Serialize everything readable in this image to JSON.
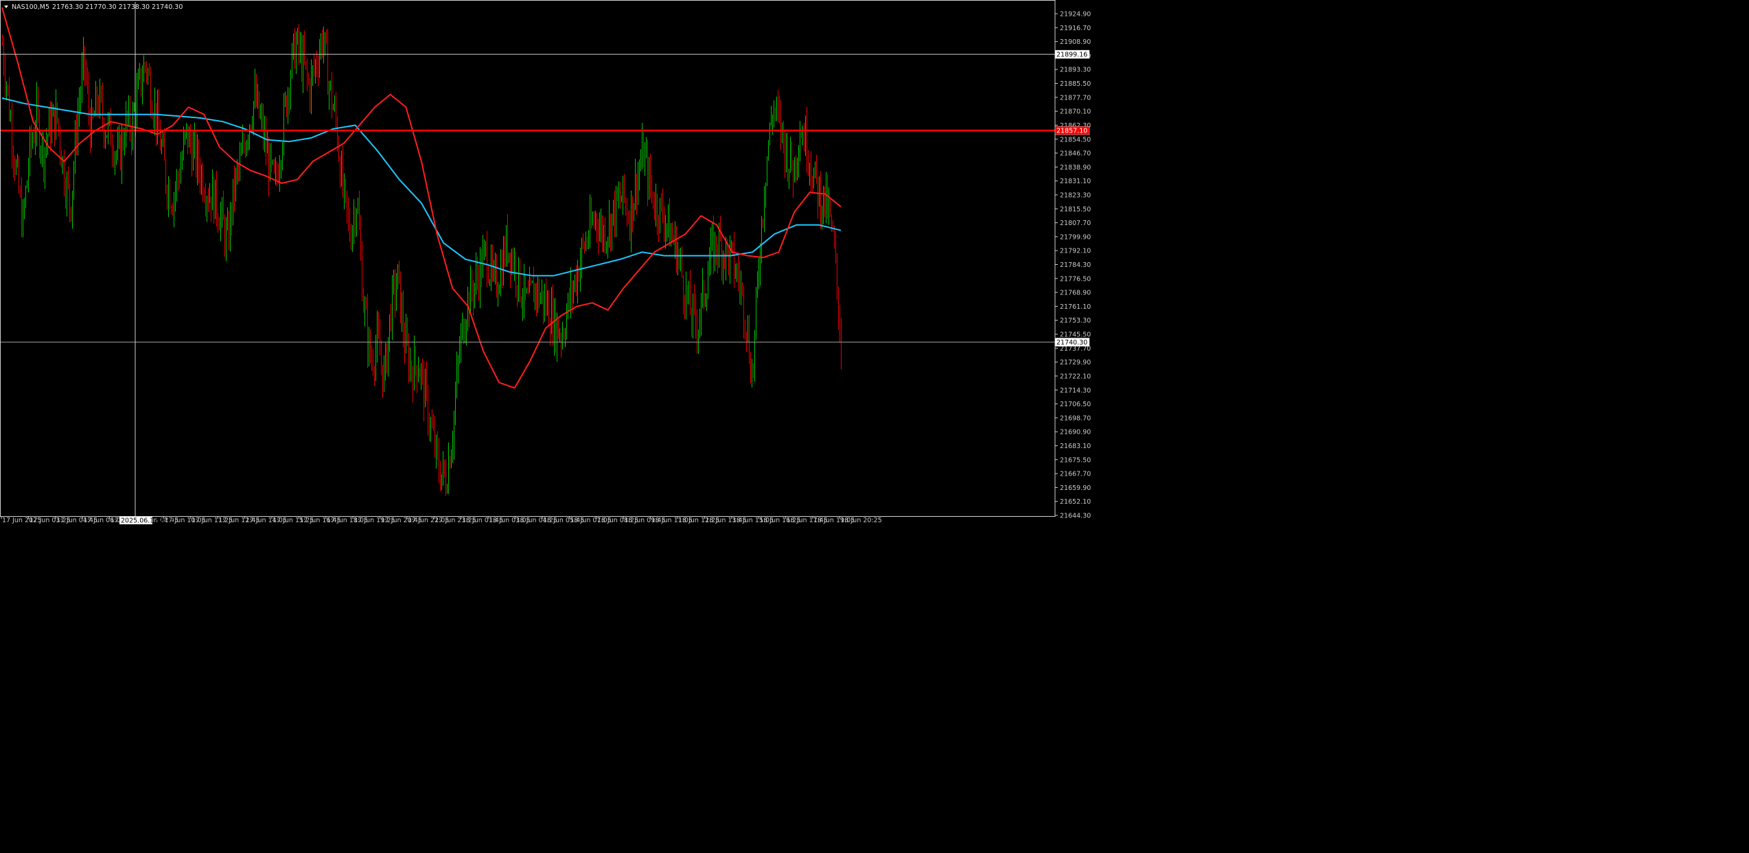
{
  "header": {
    "symbol": "NAS100,M5",
    "ohlc_text": "21763.30 21770.30 21738.30 21740.30"
  },
  "crosshair": {
    "time_label": "2025.06.17 8:40",
    "price_label": "21899.16"
  },
  "price_markers": {
    "bid_line_label": "21857.10",
    "current_price_label": "21740.30"
  },
  "colors": {
    "background": "#000000",
    "bull_candle": "#00c800",
    "bear_candle": "#e60000",
    "ma_fast": "#ff1e1e",
    "ma_slow": "#1ec8ff",
    "horizontal_line": "#ff0000",
    "crosshair": "#d0d0d0",
    "axis_text": "#c8c8c8"
  },
  "chart_data": {
    "type": "candlestick",
    "symbol": "NAS100",
    "timeframe": "M5",
    "ylim": [
      21644.3,
      21928.0
    ],
    "grid": false,
    "y_ticks": [
      "21924.90",
      "21916.70",
      "21908.90",
      "21901.10",
      "21893.30",
      "21885.50",
      "21877.70",
      "21870.10",
      "21862.30",
      "21854.50",
      "21846.70",
      "21838.90",
      "21831.10",
      "21823.30",
      "21815.50",
      "21807.70",
      "21799.90",
      "21792.10",
      "21784.30",
      "21776.50",
      "21768.90",
      "21761.10",
      "21753.30",
      "21745.50",
      "21737.70",
      "21729.90",
      "21722.10",
      "21714.30",
      "21706.50",
      "21698.70",
      "21690.90",
      "21683.10",
      "21675.50",
      "21667.70",
      "21659.90",
      "21652.10",
      "21644.30"
    ],
    "x_ticks": [
      "17 Jun 2025",
      "17 Jun 03:25",
      "17 Jun 04:45",
      "17 Jun 06:05",
      "17 Jun 07:25",
      "17 Jun 08:45",
      "17 Jun 10:05",
      "17 Jun 11:25",
      "17 Jun 12:45",
      "17 Jun 14:05",
      "17 Jun 15:25",
      "17 Jun 16:45",
      "17 Jun 18:05",
      "17 Jun 19:25",
      "17 Jun 20:45",
      "17 Jun 22:05",
      "17 Jun 23:25",
      "18 Jun 01:45",
      "18 Jun 03:05",
      "18 Jun 04:25",
      "18 Jun 05:45",
      "18 Jun 07:05",
      "18 Jun 08:25",
      "18 Jun 09:45",
      "18 Jun 11:05",
      "18 Jun 12:25",
      "18 Jun 13:45",
      "18 Jun 15:05",
      "18 Jun 16:25",
      "18 Jun 17:45",
      "18 Jun 19:05",
      "18 Jun 20:25"
    ],
    "price_path": [
      21905,
      21870,
      21835,
      21805,
      21845,
      21865,
      21845,
      21860,
      21865,
      21835,
      21815,
      21865,
      21895,
      21855,
      21875,
      21860,
      21855,
      21840,
      21860,
      21860,
      21880,
      21895,
      21875,
      21855,
      21830,
      21820,
      21835,
      21855,
      21845,
      21835,
      21825,
      21820,
      21810,
      21795,
      21825,
      21840,
      21860,
      21875,
      21860,
      21840,
      21825,
      21855,
      21885,
      21905,
      21895,
      21880,
      21895,
      21910,
      21880,
      21860,
      21820,
      21800,
      21820,
      21760,
      21730,
      21740,
      21720,
      21760,
      21775,
      21740,
      21725,
      21730,
      21710,
      21690,
      21670,
      21665,
      21690,
      21735,
      21760,
      21770,
      21780,
      21790,
      21770,
      21780,
      21795,
      21785,
      21770,
      21760,
      21770,
      21765,
      21760,
      21750,
      21745,
      21760,
      21775,
      21790,
      21800,
      21810,
      21800,
      21805,
      21815,
      21820,
      21810,
      21830,
      21845,
      21825,
      21815,
      21810,
      21800,
      21790,
      21770,
      21755,
      21750,
      21770,
      21790,
      21795,
      21790,
      21785,
      21775,
      21755,
      21720,
      21790,
      21840,
      21870,
      21860,
      21845,
      21835,
      21860,
      21850,
      21830,
      21820,
      21815,
      21790,
      21740
    ],
    "ma_fast": [
      21925,
      21895,
      21862,
      21848,
      21840,
      21850,
      21857,
      21862,
      21860,
      21858,
      21855,
      21860,
      21870,
      21866,
      21848,
      21840,
      21835,
      21832,
      21828,
      21830,
      21840,
      21845,
      21850,
      21860,
      21870,
      21877,
      21870,
      21840,
      21800,
      21770,
      21760,
      21735,
      21718,
      21715,
      21730,
      21748,
      21755,
      21760,
      21762,
      21758,
      21770,
      21780,
      21790,
      21795,
      21800,
      21810,
      21805,
      21790,
      21788,
      21787,
      21790,
      21812,
      21823,
      21822,
      21815
    ],
    "ma_slow": [
      21875,
      21872,
      21870,
      21868,
      21866,
      21866,
      21866,
      21866,
      21865,
      21864,
      21862,
      21858,
      21852,
      21851,
      21853,
      21858,
      21860,
      21846,
      21830,
      21817,
      21795,
      21786,
      21783,
      21779,
      21777,
      21777,
      21780,
      21783,
      21786,
      21790,
      21788,
      21788,
      21788,
      21788,
      21790,
      21800,
      21805,
      21805,
      21802
    ],
    "bid_line_value": 21857.1,
    "current_price": 21740.3,
    "crosshair_price": 21899.16
  }
}
